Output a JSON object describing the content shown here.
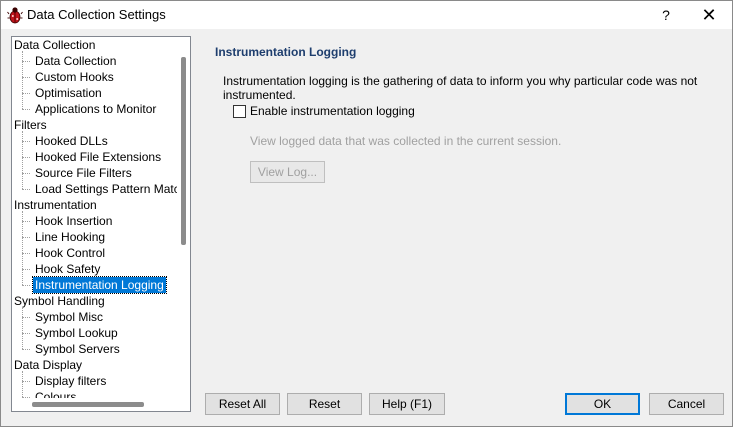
{
  "window": {
    "title": "Data Collection Settings",
    "help_glyph": "?",
    "close_glyph": "✕"
  },
  "tree": {
    "groups": [
      {
        "label": "Data Collection",
        "children": [
          "Data Collection",
          "Custom Hooks",
          "Optimisation",
          "Applications to Monitor"
        ]
      },
      {
        "label": "Filters",
        "children": [
          "Hooked DLLs",
          "Hooked File Extensions",
          "Source File Filters",
          "Load Settings Pattern Match"
        ]
      },
      {
        "label": "Instrumentation",
        "children": [
          "Hook Insertion",
          "Line Hooking",
          "Hook Control",
          "Hook Safety",
          "Instrumentation Logging"
        ]
      },
      {
        "label": "Symbol Handling",
        "children": [
          "Symbol Misc",
          "Symbol Lookup",
          "Symbol Servers"
        ]
      },
      {
        "label": "Data Display",
        "children": [
          "Display filters",
          "Colours"
        ]
      }
    ],
    "selected": "Instrumentation Logging"
  },
  "panel": {
    "title": "Instrumentation Logging",
    "description": "Instrumentation logging is the gathering of data to inform you why particular code was not instrumented.",
    "checkbox_label": "Enable instrumentation logging",
    "checkbox_checked": false,
    "hint": "View logged data that was collected in the current session.",
    "view_log_label": "View Log..."
  },
  "buttons": {
    "reset_all": "Reset All",
    "reset": "Reset",
    "help": "Help (F1)",
    "ok": "OK",
    "cancel": "Cancel"
  },
  "colors": {
    "selection": "#0078d7",
    "panel_title": "#1e3e6e"
  }
}
